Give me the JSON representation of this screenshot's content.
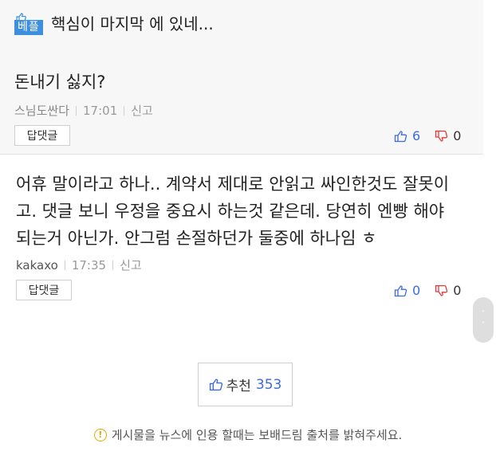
{
  "best_comment": {
    "badge": "베플",
    "title": "핵심이 마지막 에 있네...",
    "text": "돈내기 싫지?",
    "author": "스님도싼다",
    "time": "17:01",
    "report": "신고",
    "reply_label": "답댓글",
    "upvotes": "6",
    "downvotes": "0"
  },
  "comment2": {
    "text_lines": [
      "어휴 말이라고 하나.. 계약서 제대로 안읽고 싸인한것도 잘못이",
      "고. 댓글 보니 우정을 중요시 하는것 같은데. 당연히 엔빵 해야",
      "되는거 아닌가. 안그럼 손절하던가 둘중에 하나임 ㅎ"
    ],
    "author": "kakaxo",
    "time": "17:35",
    "report": "신고",
    "reply_label": "답댓글",
    "upvotes": "0",
    "downvotes": "0"
  },
  "recommend": {
    "label": "추천",
    "count": "353"
  },
  "notice": {
    "icon_glyph": "!",
    "text": "게시물을 뉴스에 인용 할때는 보배드림 출처를 밝혀주세요."
  },
  "scroll": {
    "up_glyph": "˄",
    "down_glyph": "˅"
  },
  "colors": {
    "accent_blue": "#3d6bd8",
    "badge_blue": "#3d8fe0",
    "downvote_red": "#e03a3a",
    "notice_icon": "#e0a800"
  }
}
